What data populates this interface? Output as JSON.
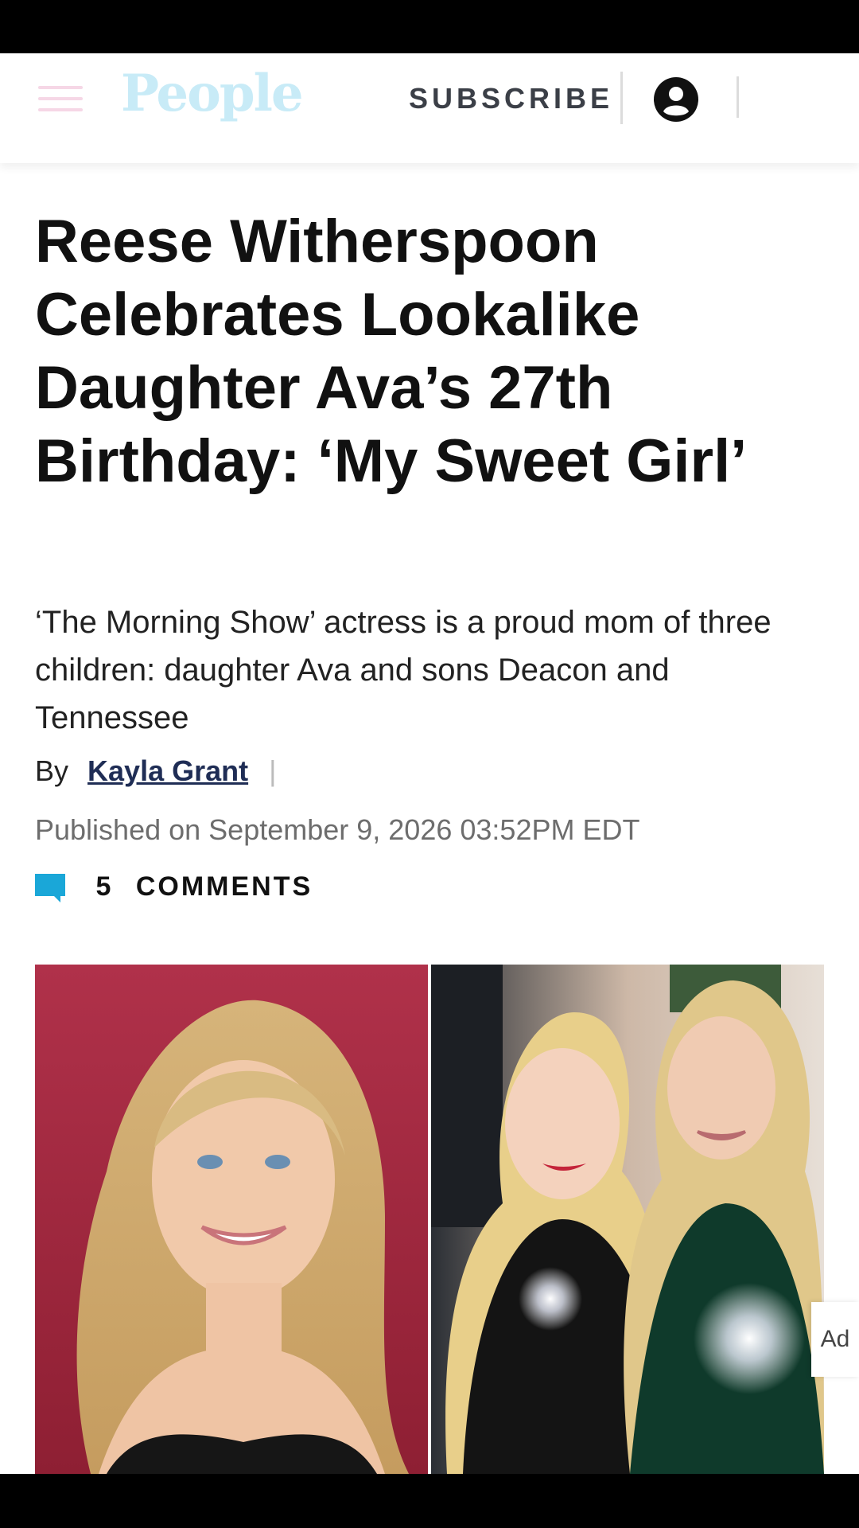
{
  "header": {
    "logo_text": "People",
    "subscribe_label": "SUBSCRIBE"
  },
  "article": {
    "title": "Reese Witherspoon Celebrates Lookalike Daughter Ava’s 27th Birthday: ‘My Sweet Girl’",
    "subtitle": "‘The Morning Show’ actress is a proud mom of three children: daughter Ava and sons Deacon and Tennessee",
    "byline_prefix": "By",
    "author": "Kayla Grant",
    "published": "Published on September 9, 2026 03:52PM EDT",
    "comments_count": "5",
    "comments_label": "COMMENTS"
  },
  "ad": {
    "label": "Ad"
  },
  "colors": {
    "accent_blue": "#1aa7d8",
    "author_navy": "#1f2d55",
    "photo_left_bg": "#a5283c"
  }
}
